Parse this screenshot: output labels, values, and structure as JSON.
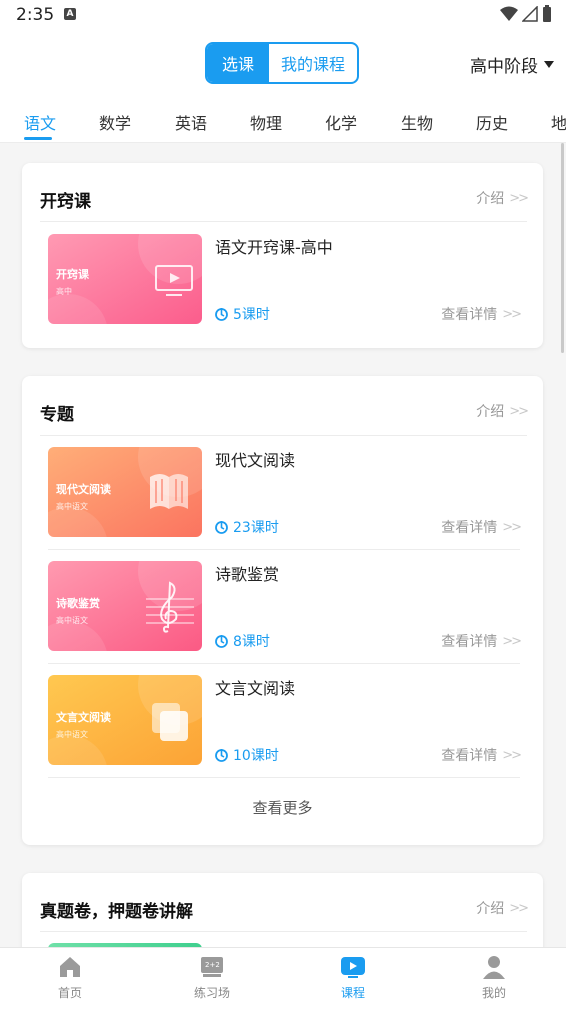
{
  "status_bar": {
    "time": "2:35",
    "notification_badge": "A"
  },
  "header": {
    "segments": [
      "选课",
      "我的课程"
    ],
    "active_segment": "选课",
    "stage_label": "高中阶段"
  },
  "subject_tabs": [
    "语文",
    "数学",
    "英语",
    "物理",
    "化学",
    "生物",
    "历史",
    "地"
  ],
  "active_subject": "语文",
  "sections": [
    {
      "title": "开窍课",
      "intro_label": "介绍",
      "courses": [
        {
          "name": "语文开窍课-高中",
          "lessons": "5课时",
          "detail_label": "查看详情",
          "thumb_title": "开窍课",
          "thumb_sub": "高中",
          "thumb_colors": [
            "#ff8aa8",
            "#fb5b8c"
          ],
          "thumb_icon": "tv-icon"
        }
      ]
    },
    {
      "title": "专题",
      "intro_label": "介绍",
      "courses": [
        {
          "name": "现代文阅读",
          "lessons": "23课时",
          "detail_label": "查看详情",
          "thumb_title": "现代文阅读",
          "thumb_sub": "高中语文",
          "thumb_colors": [
            "#ffa06e",
            "#fb7a64"
          ],
          "thumb_icon": "book-icon"
        },
        {
          "name": "诗歌鉴赏",
          "lessons": "8课时",
          "detail_label": "查看详情",
          "thumb_title": "诗歌鉴赏",
          "thumb_sub": "高中语文",
          "thumb_colors": [
            "#ff8aa0",
            "#fb5f86"
          ],
          "thumb_icon": "treble-clef-icon"
        },
        {
          "name": "文言文阅读",
          "lessons": "10课时",
          "detail_label": "查看详情",
          "thumb_title": "文言文阅读",
          "thumb_sub": "高中语文",
          "thumb_colors": [
            "#ffc048",
            "#fca73a"
          ],
          "thumb_icon": "cards-icon"
        }
      ],
      "more_label": "查看更多"
    },
    {
      "title": "真题卷，押题卷讲解",
      "intro_label": "介绍",
      "courses": []
    }
  ],
  "bottom_nav": [
    {
      "label": "首页",
      "icon": "home-icon",
      "active": false
    },
    {
      "label": "练习场",
      "icon": "blackboard-icon",
      "active": false
    },
    {
      "label": "课程",
      "icon": "play-screen-icon",
      "active": true
    },
    {
      "label": "我的",
      "icon": "user-icon",
      "active": false
    }
  ],
  "colors": {
    "accent": "#1a9cf0",
    "muted": "#999999"
  }
}
